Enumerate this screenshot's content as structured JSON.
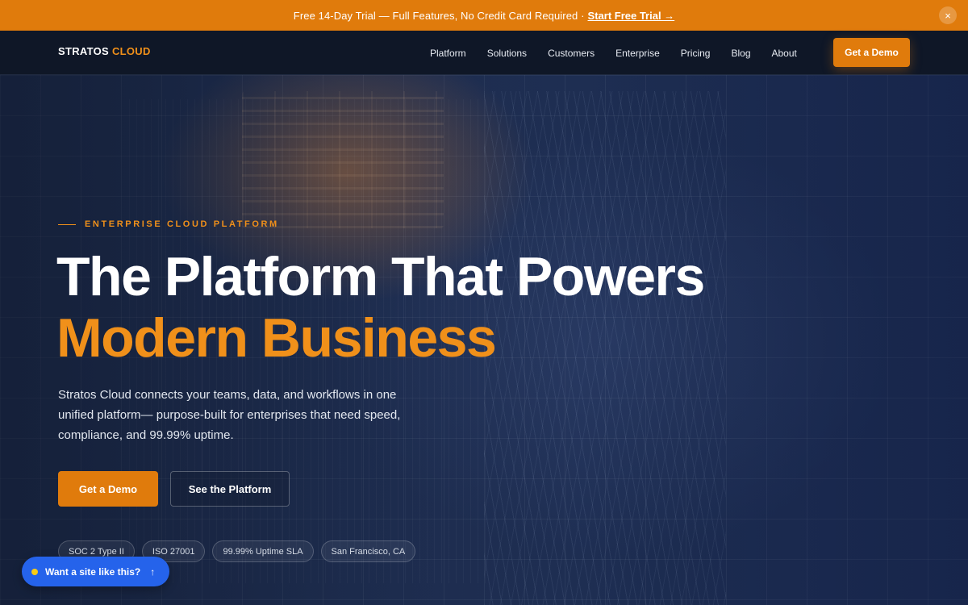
{
  "announcement": {
    "text": "Free 14-Day Trial — Full Features, No Credit Card Required ·",
    "cta": "Start Free Trial →",
    "close_icon": "×"
  },
  "nav": {
    "logo_primary": "STRATOS",
    "logo_accent": "CLOUD",
    "links": [
      "Platform",
      "Solutions",
      "Customers",
      "Enterprise",
      "Pricing",
      "Blog",
      "About"
    ],
    "cta": "Get a Demo"
  },
  "hero": {
    "eyebrow": "ENTERPRISE CLOUD PLATFORM",
    "headline_line1": "The Platform That Powers",
    "headline_line2": "Modern Business",
    "description": "Stratos Cloud connects your teams, data, and workflows in one unified platform— purpose-built for enterprises that need speed, compliance, and 99.99% uptime.",
    "primary_cta": "Get a Demo",
    "secondary_cta": "See the Platform",
    "badges": [
      "SOC 2 Type II",
      "ISO 27001",
      "99.99% Uptime SLA",
      "San Francisco, CA"
    ]
  },
  "widget": {
    "label": "Want a site like this?",
    "arrow": "↑"
  },
  "colors": {
    "accent": "#e07b0c",
    "accent_text": "#f0901a",
    "nav_bg": "#0f1727",
    "widget_bg": "#2563eb"
  }
}
